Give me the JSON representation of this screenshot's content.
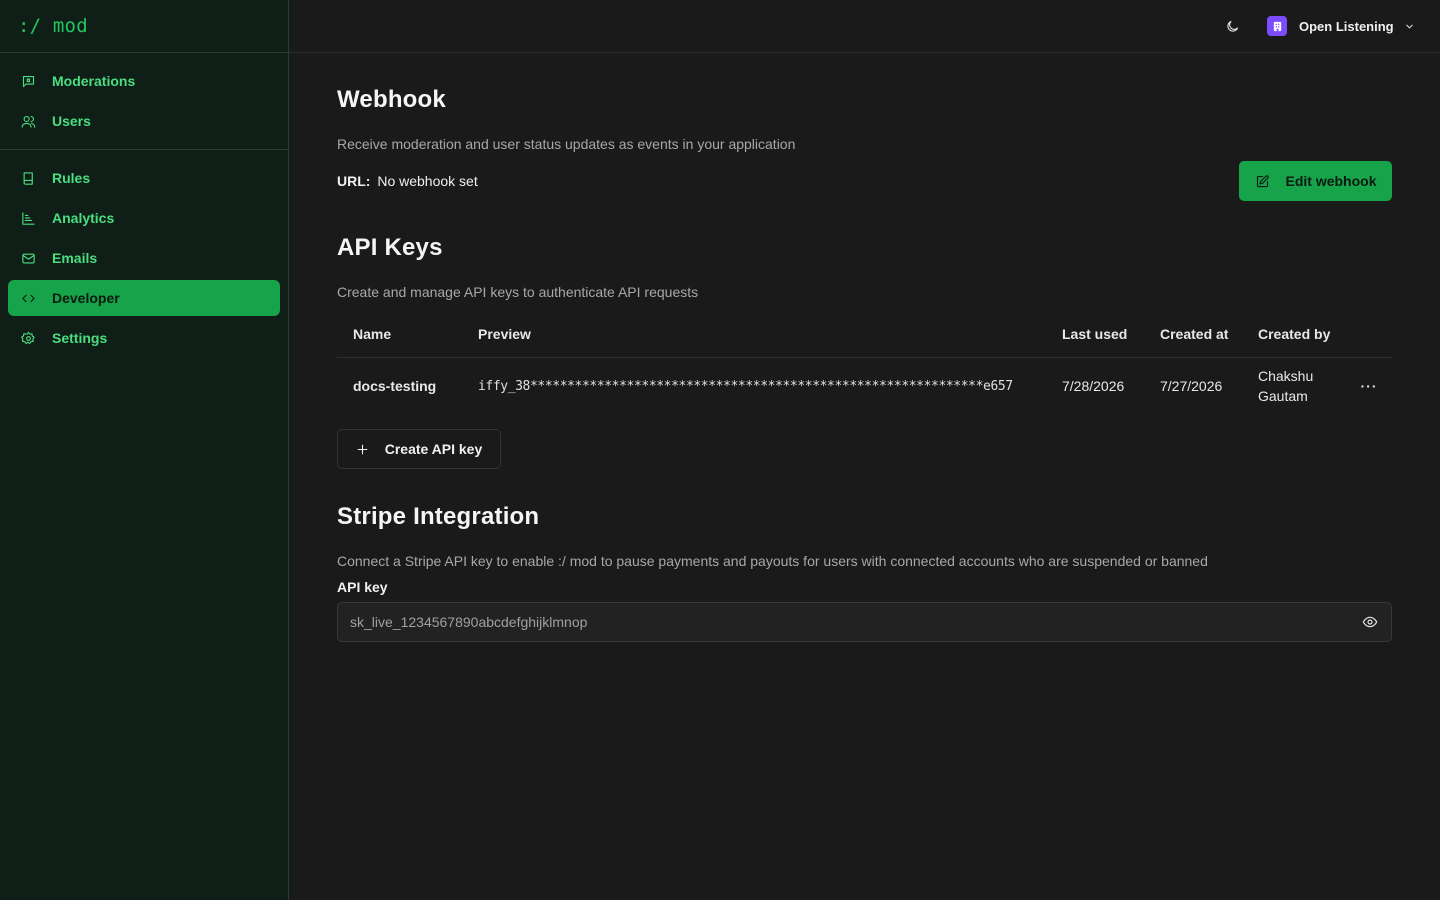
{
  "app": {
    "logo": ":/ mod",
    "accent_color": "#22c55e",
    "active_color": "#16a34a"
  },
  "sidebar": {
    "primary": [
      {
        "label": "Moderations",
        "icon": "flag-icon"
      },
      {
        "label": "Users",
        "icon": "users-icon"
      }
    ],
    "secondary": [
      {
        "label": "Rules",
        "icon": "book-icon"
      },
      {
        "label": "Analytics",
        "icon": "chart-icon"
      },
      {
        "label": "Emails",
        "icon": "mail-icon"
      },
      {
        "label": "Developer",
        "icon": "code-icon",
        "active": true
      },
      {
        "label": "Settings",
        "icon": "gear-icon"
      }
    ]
  },
  "header": {
    "theme_icon": "moon-icon",
    "org_name": "Open Listening",
    "org_color": "#7c4dff"
  },
  "webhook": {
    "title": "Webhook",
    "description": "Receive moderation and user status updates as events in your application",
    "url_label": "URL:",
    "url_value": "No webhook set",
    "edit_button": "Edit webhook"
  },
  "api_keys": {
    "title": "API Keys",
    "description": "Create and manage API keys to authenticate API requests",
    "columns": [
      "Name",
      "Preview",
      "Last used",
      "Created at",
      "Created by"
    ],
    "rows": [
      {
        "name": "docs-testing",
        "preview": "iffy_38*************************************************************e657",
        "last_used": "7/28/2026",
        "created_at": "7/27/2026",
        "created_by": "Chakshu Gautam"
      }
    ],
    "create_button": "Create API key"
  },
  "stripe": {
    "title": "Stripe Integration",
    "description": "Connect a Stripe API key to enable :/ mod to pause payments and payouts for users with connected accounts who are suspended or banned",
    "field_label": "API key",
    "api_key_value": "sk_live_1234567890abcdefghijklmnop"
  }
}
